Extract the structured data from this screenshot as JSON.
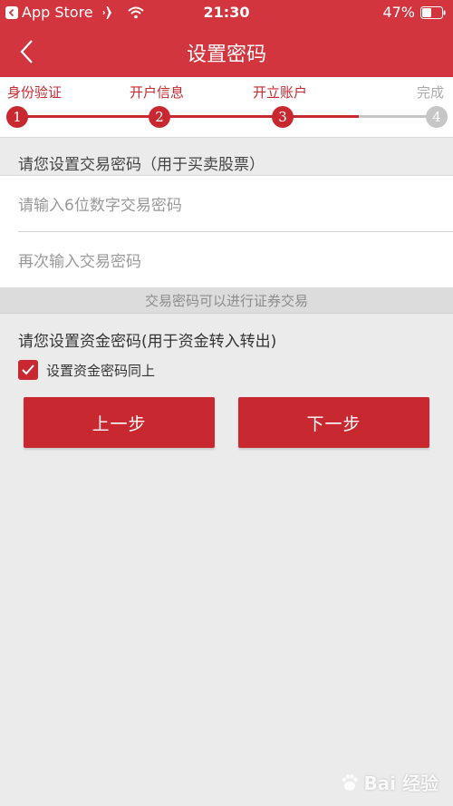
{
  "status_bar": {
    "back_app": "App Store",
    "time": "21:30",
    "battery": "47%"
  },
  "nav": {
    "title": "设置密码"
  },
  "stepper": {
    "steps": [
      {
        "label": "身份验证",
        "number": "1",
        "state": "done"
      },
      {
        "label": "开户信息",
        "number": "2",
        "state": "done"
      },
      {
        "label": "开立账户",
        "number": "3",
        "state": "current"
      },
      {
        "label": "完成",
        "number": "4",
        "state": "pending"
      }
    ],
    "accent_color": "#c8282f",
    "pending_color": "#c6c6c6"
  },
  "trade_password": {
    "section_title": "请您设置交易密码（用于买卖股票）",
    "input_placeholder": "请输入6位数字交易密码",
    "confirm_placeholder": "再次输入交易密码",
    "hint": "交易密码可以进行证券交易"
  },
  "fund_password": {
    "section_title": "请您设置资金密码(用于资金转入转出)",
    "same_as_above_label": "设置资金密码同上",
    "same_as_above_checked": true
  },
  "buttons": {
    "prev": "上一步",
    "next": "下一步"
  },
  "watermark": {
    "text": "Bai 经验"
  },
  "colors": {
    "header": "#d2353e",
    "accent": "#c8282f",
    "background": "#ebebeb"
  }
}
